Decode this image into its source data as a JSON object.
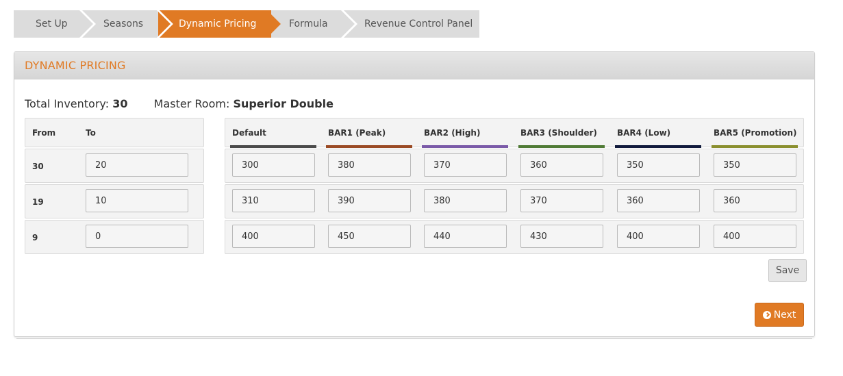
{
  "wizard": {
    "steps": [
      {
        "label": "Set Up"
      },
      {
        "label": "Seasons"
      },
      {
        "label": "Dynamic Pricing"
      },
      {
        "label": "Formula"
      },
      {
        "label": "Revenue Control Panel"
      }
    ],
    "active_step": "Dynamic Pricing"
  },
  "panel": {
    "title": "DYNAMIC PRICING"
  },
  "summary": {
    "inventory_label": "Total Inventory:",
    "inventory_value": "30",
    "master_room_label": "Master Room:",
    "master_room_value": "Superior Double"
  },
  "range_table": {
    "headers": {
      "from": "From",
      "to": "To"
    },
    "rows": [
      {
        "from": "30",
        "to": "20"
      },
      {
        "from": "19",
        "to": "10"
      },
      {
        "from": "9",
        "to": "0"
      }
    ]
  },
  "price_table": {
    "columns": [
      {
        "label": "Default",
        "color": "#4a4a4a"
      },
      {
        "label": "BAR1 (Peak)",
        "color": "#9a4a24"
      },
      {
        "label": "BAR2 (High)",
        "color": "#7a5aa8"
      },
      {
        "label": "BAR3 (Shoulder)",
        "color": "#4f7a35"
      },
      {
        "label": "BAR4 (Low)",
        "color": "#111a3c"
      },
      {
        "label": "BAR5 (Promotion)",
        "color": "#8a8f2e"
      }
    ],
    "rows": [
      [
        "300",
        "380",
        "370",
        "360",
        "350",
        "350"
      ],
      [
        "310",
        "390",
        "380",
        "370",
        "360",
        "360"
      ],
      [
        "400",
        "450",
        "440",
        "430",
        "400",
        "400"
      ]
    ]
  },
  "buttons": {
    "save": "Save",
    "next": "Next"
  },
  "colors": {
    "accent": "#e07a24"
  }
}
